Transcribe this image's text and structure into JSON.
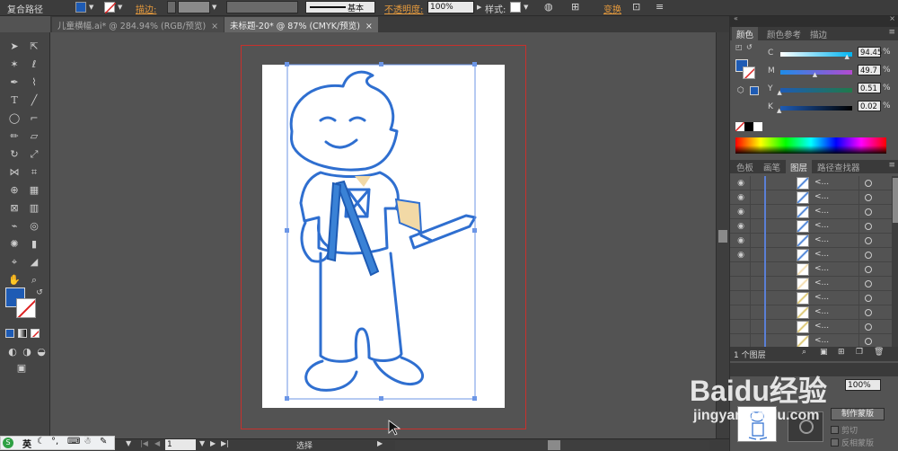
{
  "control_bar": {
    "mode_label": "复合路径",
    "stroke_label": "描边:",
    "stroke_style": "基本",
    "opacity_label": "不透明度:",
    "opacity_value": "100%",
    "style_label": "样式:",
    "transform_label": "变换",
    "fill_color": "#1e5bb4"
  },
  "tabs": [
    {
      "label": "儿童横幅.ai* @ 284.94% (RGB/预览)",
      "close": "×"
    },
    {
      "label": "未标题-20* @ 87% (CMYK/预览)",
      "close": "×"
    }
  ],
  "status": {
    "page_value": "1",
    "mode_text": "选择"
  },
  "color_panel": {
    "tabs": [
      "颜色",
      "颜色参考",
      "描边"
    ],
    "channels": [
      {
        "name": "C",
        "value": "94.45",
        "unit": "%",
        "level": 94.45
      },
      {
        "name": "M",
        "value": "49.7",
        "unit": "%",
        "level": 49.7
      },
      {
        "name": "Y",
        "value": "0.51",
        "unit": "%",
        "level": 0.51
      },
      {
        "name": "K",
        "value": "0.02",
        "unit": "%",
        "level": 0.02
      }
    ]
  },
  "layers_panel": {
    "tabs": [
      "色板",
      "画笔",
      "图层",
      "路径查找器"
    ],
    "placeholder": "<...",
    "rows": 12,
    "footer": "1 个图层"
  },
  "bottom_panel": {
    "opacity_value": "100%",
    "make_mask_label": "制作蒙版",
    "clip_label": "剪切",
    "invert_label": "反相蒙版"
  },
  "ime": {
    "label": "英"
  },
  "watermark": {
    "brand": "Baidu经验",
    "url": "jingyan.baidu.com"
  },
  "colors": {
    "accent_blue": "#1e5bb4",
    "artboard_border": "#c8302c",
    "stroke_blue": "#2f6fd0"
  }
}
